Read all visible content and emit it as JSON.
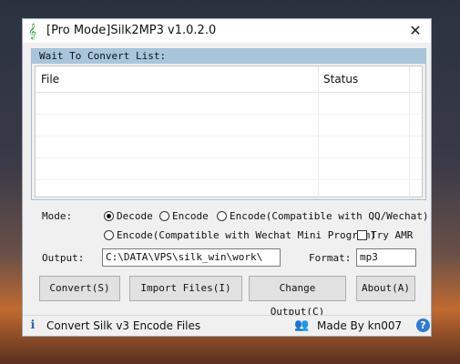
{
  "window": {
    "title": "[Pro Mode]Silk2MP3 v1.0.2.0",
    "close_symbol": "✕"
  },
  "list": {
    "header": "Wait To Convert List:",
    "columns": [
      "File",
      "Status"
    ]
  },
  "mode": {
    "label": "Mode:",
    "options": [
      {
        "label": "Decode",
        "checked": true
      },
      {
        "label": "Encode",
        "checked": false
      },
      {
        "label": "Encode(Compatible with QQ/Wechat)",
        "checked": false
      },
      {
        "label": "Encode(Compatible with Wechat Mini Program)",
        "checked": false
      }
    ],
    "try_amr": {
      "label": "Try AMR",
      "checked": false
    }
  },
  "output": {
    "label": "Output:",
    "value": "C:\\DATA\\VPS\\silk_win\\work\\"
  },
  "format": {
    "label": "Format:",
    "value": "mp3"
  },
  "buttons": {
    "convert": "Convert(S)",
    "import": "Import Files(I)",
    "change_output": "Change Output(C)",
    "about": "About(A)"
  },
  "statusbar": {
    "message": "Convert Silk v3 Encode Files",
    "author": "Made By kn007",
    "help_symbol": "?"
  }
}
